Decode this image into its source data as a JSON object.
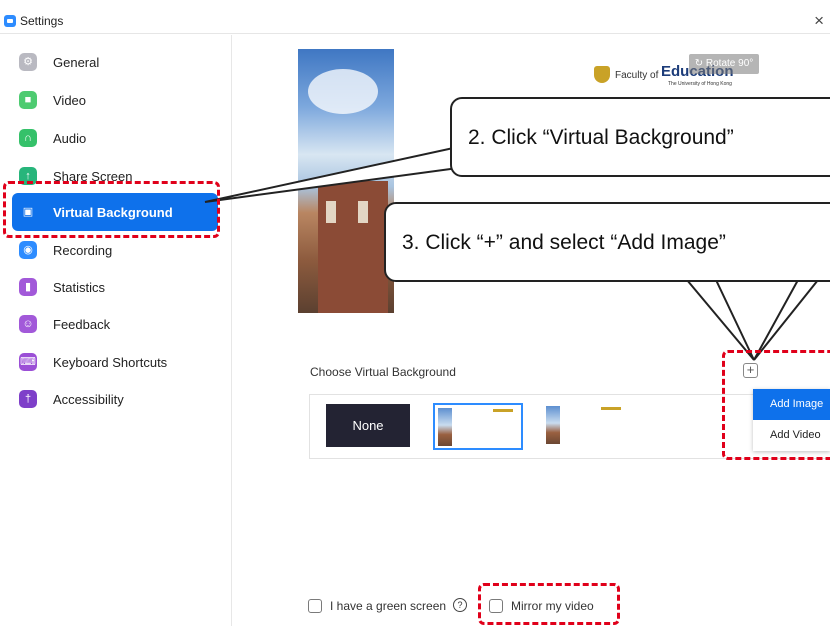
{
  "window": {
    "title": "Settings",
    "close_glyph": "×"
  },
  "sidebar": {
    "items": [
      {
        "label": "General",
        "icon": "gear-icon",
        "color": "#b9b9c1",
        "glyph": "⚙"
      },
      {
        "label": "Video",
        "icon": "video-camera-icon",
        "color": "#4ecb71",
        "glyph": "■"
      },
      {
        "label": "Audio",
        "icon": "headphones-icon",
        "color": "#35c16a",
        "glyph": "∩"
      },
      {
        "label": "Share Screen",
        "icon": "share-screen-icon",
        "color": "#27b57b",
        "glyph": "↑"
      },
      {
        "label": "Virtual Background",
        "icon": "virtual-background-icon",
        "color": "#0e71eb",
        "glyph": "▣"
      },
      {
        "label": "Recording",
        "icon": "recording-icon",
        "color": "#2d8cff",
        "glyph": "◉"
      },
      {
        "label": "Statistics",
        "icon": "statistics-icon",
        "color": "#a259d9",
        "glyph": "▮"
      },
      {
        "label": "Feedback",
        "icon": "feedback-icon",
        "color": "#a259d9",
        "glyph": "☺"
      },
      {
        "label": "Keyboard Shortcuts",
        "icon": "keyboard-icon",
        "color": "#9b4fd6",
        "glyph": "⌨"
      },
      {
        "label": "Accessibility",
        "icon": "accessibility-icon",
        "color": "#7e3fc9",
        "glyph": "†"
      }
    ],
    "active_index": 4
  },
  "preview": {
    "rotate_label": "↻ Rotate 90°",
    "brand_faculty": "Faculty of",
    "brand_education": "Education",
    "brand_university": "The University of Hong Kong"
  },
  "choose": {
    "title": "Choose Virtual Background",
    "add_glyph": "+",
    "none_label": "None"
  },
  "add_menu": {
    "items": [
      "Add Image",
      "Add Video"
    ],
    "highlighted_index": 0
  },
  "footer": {
    "green_screen_label": "I have a green screen",
    "help_glyph": "?",
    "mirror_label": "Mirror my video"
  },
  "annotations": {
    "step2": "2. Click “Virtual Background”",
    "step3": "3. Click “+” and select “Add Image”",
    "highlight_color": "#e0001a"
  }
}
